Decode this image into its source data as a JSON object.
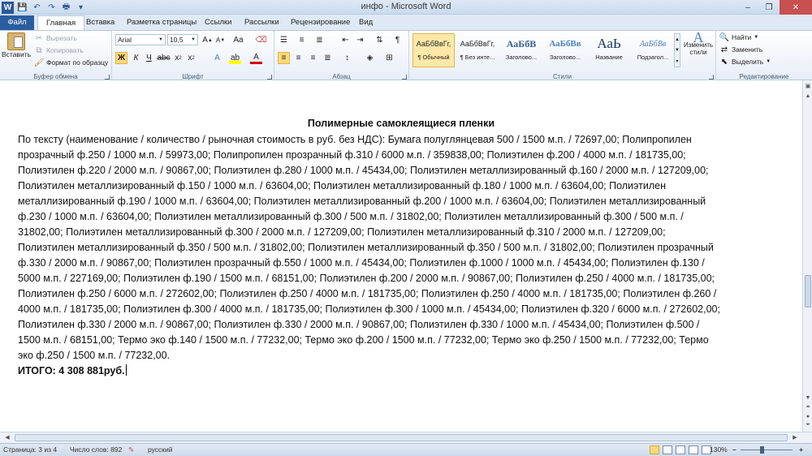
{
  "window": {
    "title": "инфо - Microsoft Word",
    "quick_access": [
      "W",
      "💾",
      "↶",
      "↷",
      "🖶",
      "▾"
    ],
    "controls": [
      "–",
      "❐",
      "✕"
    ]
  },
  "tabs": [
    {
      "label": "Файл"
    },
    {
      "label": "Главная"
    },
    {
      "label": "Вставка"
    },
    {
      "label": "Разметка страницы"
    },
    {
      "label": "Ссылки"
    },
    {
      "label": "Рассылки"
    },
    {
      "label": "Рецензирование"
    },
    {
      "label": "Вид"
    }
  ],
  "ribbon": {
    "clipboard": {
      "label": "Буфер обмена",
      "paste": "Вставить",
      "cut": "Вырезать",
      "copy": "Копировать",
      "format_painter": "Формат по образцу"
    },
    "font": {
      "label": "Шрифт",
      "font_name": "Arial",
      "font_size": "10,5"
    },
    "paragraph": {
      "label": "Абзац"
    },
    "styles": {
      "label": "Стили",
      "items": [
        {
          "sample": "АаБбВвГг,",
          "name": "¶ Обычный"
        },
        {
          "sample": "АаБбВвГг,",
          "name": "¶ Без инте..."
        },
        {
          "sample": "АаБбВ",
          "name": "Заголово..."
        },
        {
          "sample": "АаБбВв",
          "name": "Заголово..."
        },
        {
          "sample": "АаЬ",
          "name": "Название"
        },
        {
          "sample": "АаБбВв",
          "name": "Подзагол..."
        }
      ],
      "change_styles": "Изменить стили"
    },
    "editing": {
      "label": "Редактирование",
      "find": "Найти",
      "replace": "Заменить",
      "select": "Выделить"
    }
  },
  "document": {
    "title": "Полимерные самоклеящиеся пленки",
    "lines": [
      "    По тексту (наименование / количество / рыночная стоимость в руб. без НДС): Бумага полуглянцевая 500 / 1500 м.п. / 72697,00; Полипропилен",
      "прозрачный ф.250 / 1000 м.п. / 59973,00; Полипропилен прозрачный ф.310 / 6000 м.п. / 359838,00; Полиэтилен ф.200 / 4000 м.п. / 181735,00;",
      "Полиэтилен ф.220 / 2000 м.п. / 90867,00; Полиэтилен ф.280 / 1000 м.п. / 45434,00; Полиэтилен металлизированный ф.160 / 2000 м.п. / 127209,00;",
      "Полиэтилен металлизированный ф.150 / 1000 м.п. / 63604,00; Полиэтилен металлизированный ф.180 / 1000 м.п. / 63604,00; Полиэтилен",
      "металлизированный ф.190 / 1000 м.п. / 63604,00; Полиэтилен металлизированный ф.200 / 1000 м.п. / 63604,00; Полиэтилен металлизированный",
      "ф.230 / 1000 м.п. / 63604,00; Полиэтилен металлизированный ф.300 / 500 м.п. / 31802,00; Полиэтилен металлизированный ф.300 / 500 м.п. /",
      "31802,00; Полиэтилен металлизированный ф.300 / 2000 м.п. / 127209,00; Полиэтилен металлизированный ф.310 / 2000 м.п. / 127209,00;",
      "Полиэтилен металлизированный ф.350 / 500 м.п. / 31802,00; Полиэтилен металлизированный ф.350 / 500 м.п. / 31802,00; Полиэтилен прозрачный",
      "ф.330 / 2000 м.п. / 90867,00; Полиэтилен прозрачный ф.550 / 1000 м.п. / 45434,00; Полиэтилен ф.1000 / 1000 м.п. / 45434,00; Полиэтилен ф.130 /",
      "5000 м.п. / 227169,00; Полиэтилен ф.190 / 1500 м.п. / 68151,00; Полиэтилен ф.200 / 2000 м.п. / 90867,00; Полиэтилен ф.250 / 4000 м.п. / 181735,00;",
      "Полиэтилен ф.250 / 6000 м.п. / 272602,00; Полиэтилен ф.250 / 4000 м.п. / 181735,00; Полиэтилен ф.250 / 4000 м.п. / 181735,00; Полиэтилен ф.260 /",
      "4000 м.п. / 181735,00; Полиэтилен ф.300 / 4000 м.п. / 181735,00; Полиэтилен ф.300 / 1000 м.п. / 45434,00; Полиэтилен ф.320 / 6000 м.п. / 272602,00;",
      "Полиэтилен ф.330 / 2000 м.п. / 90867,00; Полиэтилен ф.330 / 2000 м.п. / 90867,00; Полиэтилен ф.330 / 1000 м.п. / 45434,00; Полиэтилен ф.500 /",
      "1500 м.п. / 68151,00; Термо эко ф.140 / 1500 м.п. / 77232,00; Термо эко ф.200 / 1500 м.п. / 77232,00; Термо эко ф.250 / 1500 м.п. / 77232,00; Термо",
      "эко ф.250 / 1500 м.п. / 77232,00."
    ],
    "total": "ИТОГО:  4 308 881руб."
  },
  "statusbar": {
    "page": "Страница: 3 из 4",
    "words": "Число слов: 892",
    "language": "русский",
    "zoom": "130%"
  }
}
